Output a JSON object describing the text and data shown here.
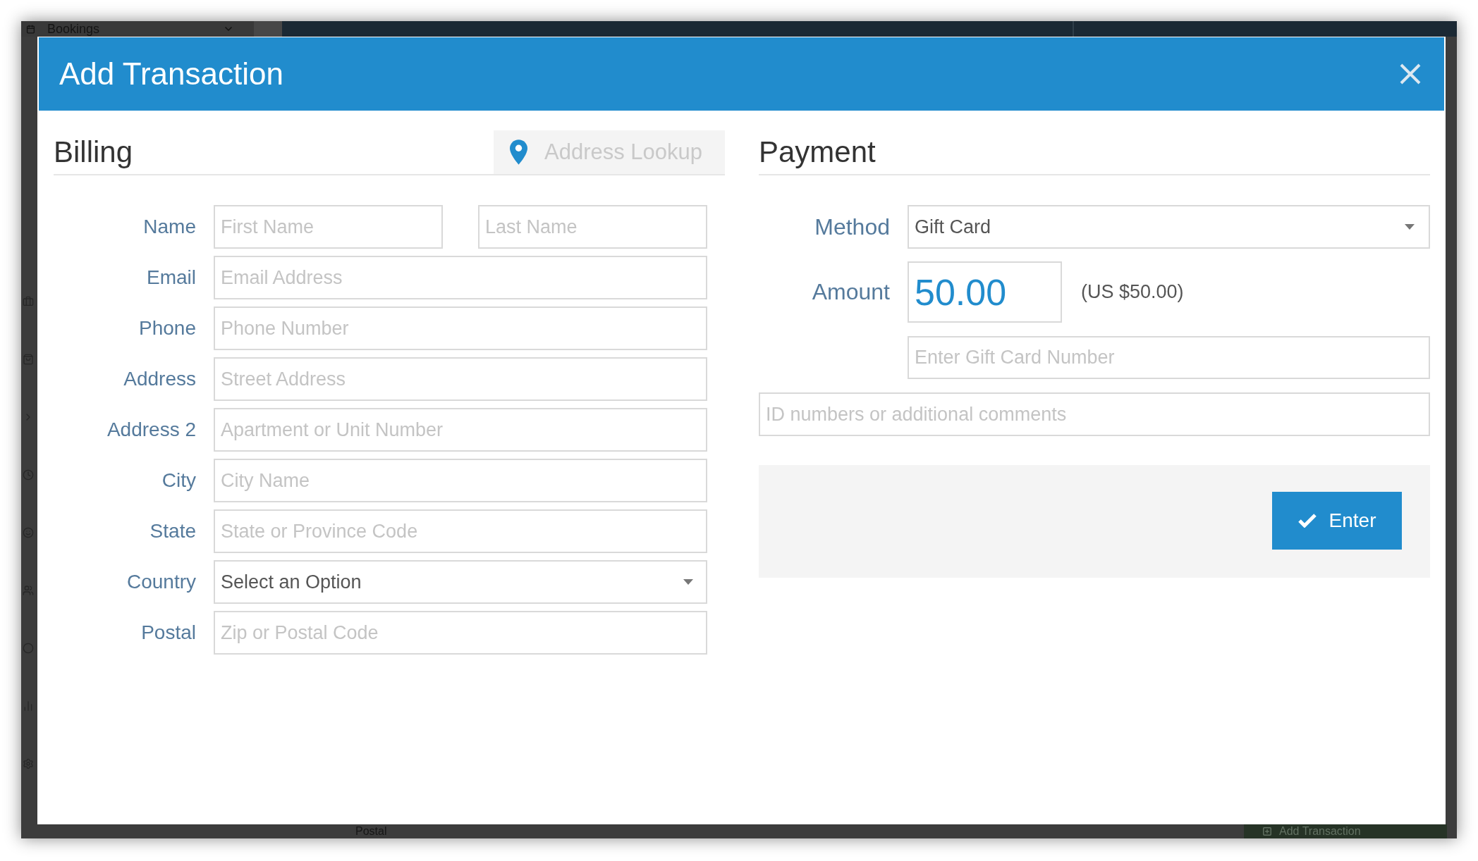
{
  "background": {
    "nav_item": "Bookings",
    "form_label": "Postal",
    "add_button": "Add Transaction"
  },
  "dialog": {
    "title": "Add Transaction",
    "billing": {
      "heading": "Billing",
      "lookup_button": "Address Lookup",
      "fields": [
        {
          "kind": "pair",
          "label": "Name",
          "inputs": [
            {
              "placeholder": "First Name"
            },
            {
              "placeholder": "Last Name"
            }
          ]
        },
        {
          "kind": "text",
          "label": "Email",
          "placeholder": "Email Address"
        },
        {
          "kind": "text",
          "label": "Phone",
          "placeholder": "Phone Number"
        },
        {
          "kind": "text",
          "label": "Address",
          "placeholder": "Street Address"
        },
        {
          "kind": "text",
          "label": "Address 2",
          "placeholder": "Apartment or Unit Number"
        },
        {
          "kind": "text",
          "label": "City",
          "placeholder": "City Name"
        },
        {
          "kind": "text",
          "label": "State",
          "placeholder": "State or Province Code"
        },
        {
          "kind": "select",
          "label": "Country",
          "value": "Select an Option"
        },
        {
          "kind": "text",
          "label": "Postal",
          "placeholder": "Zip or Postal Code"
        }
      ]
    },
    "payment": {
      "heading": "Payment",
      "method": {
        "label": "Method",
        "value": "Gift Card"
      },
      "amount": {
        "label": "Amount",
        "value": "50.00",
        "converted": "(US $50.00)"
      },
      "gift_card": {
        "placeholder": "Enter Gift Card Number"
      },
      "comments": {
        "placeholder": "ID numbers or additional comments"
      },
      "submit_button": "Enter"
    }
  }
}
